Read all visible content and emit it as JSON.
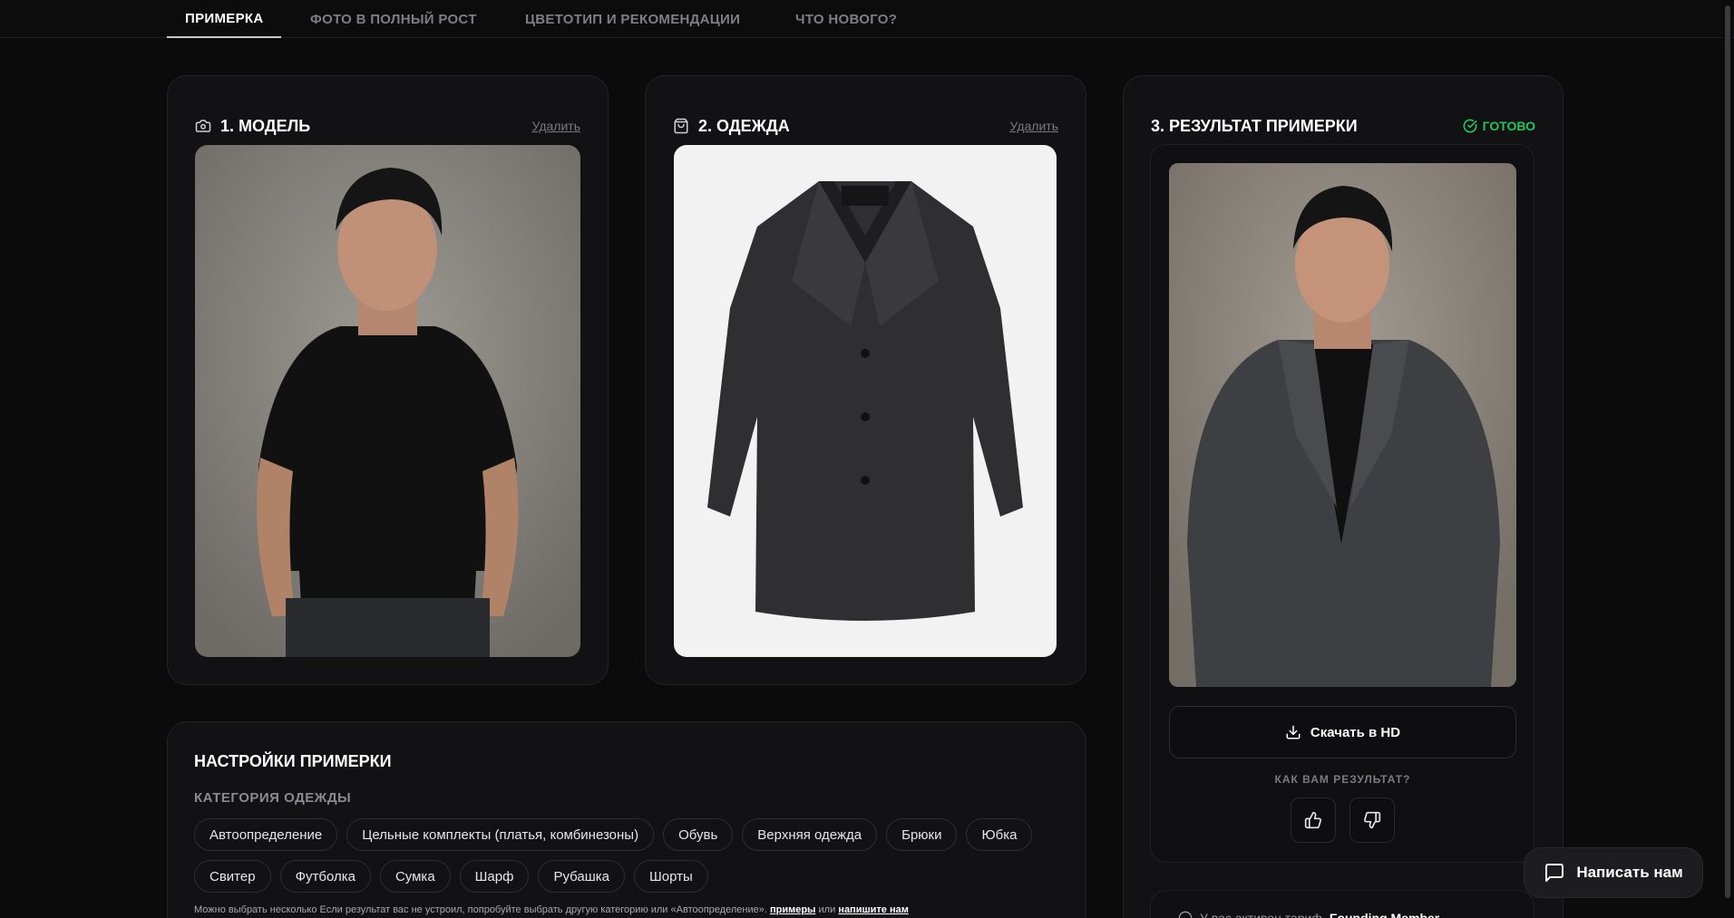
{
  "nav": {
    "tabs": [
      {
        "label": "ПРИМЕРКА"
      },
      {
        "label": "ФОТО В ПОЛНЫЙ РОСТ"
      },
      {
        "label": "ЦВЕТОТИП И РЕКОМЕНДАЦИИ"
      },
      {
        "label": "ЧТО НОВОГО?"
      }
    ]
  },
  "model": {
    "title": "1. МОДЕЛЬ",
    "delete_label": "Удалить",
    "icon": "camera-icon"
  },
  "garment": {
    "title": "2. ОДЕЖДА",
    "delete_label": "Удалить",
    "icon": "shopping-bag-icon"
  },
  "result": {
    "title": "3. РЕЗУЛЬТАТ ПРИМЕРКИ",
    "status": "ГОТОВО",
    "status_color": "#22c55e",
    "download_label": "Скачать в HD",
    "feedback_question": "КАК ВАМ РЕЗУЛЬТАТ?",
    "founding_prefix": "У вас активен тариф",
    "founding_plan": "Founding Member"
  },
  "settings": {
    "title": "НАСТРОЙКИ ПРИМЕРКИ",
    "category_label": "КАТЕГОРИЯ ОДЕЖДЫ",
    "categories": [
      "Автоопределение",
      "Цельные комплекты (платья, комбинезоны)",
      "Обувь",
      "Верхняя одежда",
      "Брюки",
      "Юбка",
      "Свитер",
      "Футболка",
      "Сумка",
      "Шарф",
      "Рубашка",
      "Шорты"
    ],
    "hint_text": "Можно выбрать несколько Если результат вас не устроил, попробуйте выбрать другую категорию или «Автоопределение».",
    "hint_link1": "примеры",
    "hint_or": "или",
    "hint_link2": "напишите нам"
  },
  "chat": {
    "label": "Написать нам",
    "icon": "chat-bubble-icon"
  }
}
